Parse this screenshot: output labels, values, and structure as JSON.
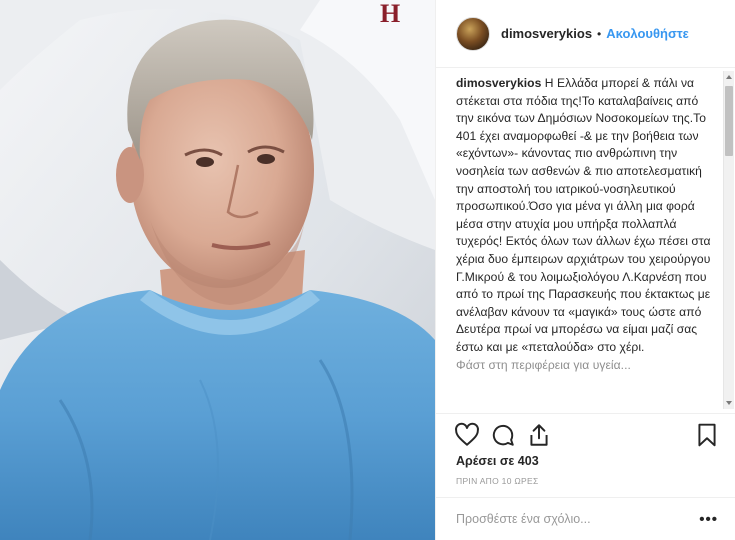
{
  "post": {
    "image_alt": "Selfie of a man in a hospital bed wearing a blue gown",
    "pillow_monogram": "H"
  },
  "header": {
    "username": "dimosverykios",
    "separator": "•",
    "follow_label": "Ακολουθήστε",
    "avatar_icon": "profile-avatar"
  },
  "caption": {
    "username": "dimosverykios",
    "text": "Η Ελλάδα μπορεί & πάλι να στέκεται στα πόδια της!Το καταλαβαίνεις από την εικόνα των Δημόσιων Νοσοκομείων της.Το 401 έχει αναμορφωθεί -& με την βοήθεια των «εχόντων»- κάνοντας πιο ανθρώπινη την νοσηλεία των ασθενών & πιο αποτελεσματική την αποστολή του ιατρικού-νοσηλευτικού προσωπικού.Όσο για μένα γι άλλη μια φορά μέσα στην ατυχία μου υπήρξα πολλαπλά τυχερός! Εκτός όλων των άλλων έχω πέσει στα χέρια δυο έμπειρων αρχιάτρων του χειρούργου Γ.Μικρού & του λοιμωξιολόγου Λ.Καρνέση που από το πρωί της Παρασκευής που έκτακτως με ανέλαβαν κάνουν τα «μαγικά» τους ώστε από Δευτέρα πρωί να μπορέσω να είμαι μαζί σας έστω και με «πεταλούδα» στο χέρι.",
    "cutoff_text": "Φάστ στη περιφέρεια για υγεία..."
  },
  "actions": {
    "like_icon": "heart-icon",
    "comment_icon": "comment-icon",
    "share_icon": "share-icon",
    "save_icon": "bookmark-icon"
  },
  "likes": {
    "label": "Αρέσει σε 403"
  },
  "timestamp": {
    "label": "ΠΡΙΝ ΑΠΟ 10 ΩΡΕΣ"
  },
  "comment": {
    "placeholder": "Προσθέστε ένα σχόλιο...",
    "more_options": "•••"
  },
  "colors": {
    "accent": "#3897f0",
    "text": "#262626",
    "muted": "#999999",
    "gown": "#5a9fd4"
  }
}
